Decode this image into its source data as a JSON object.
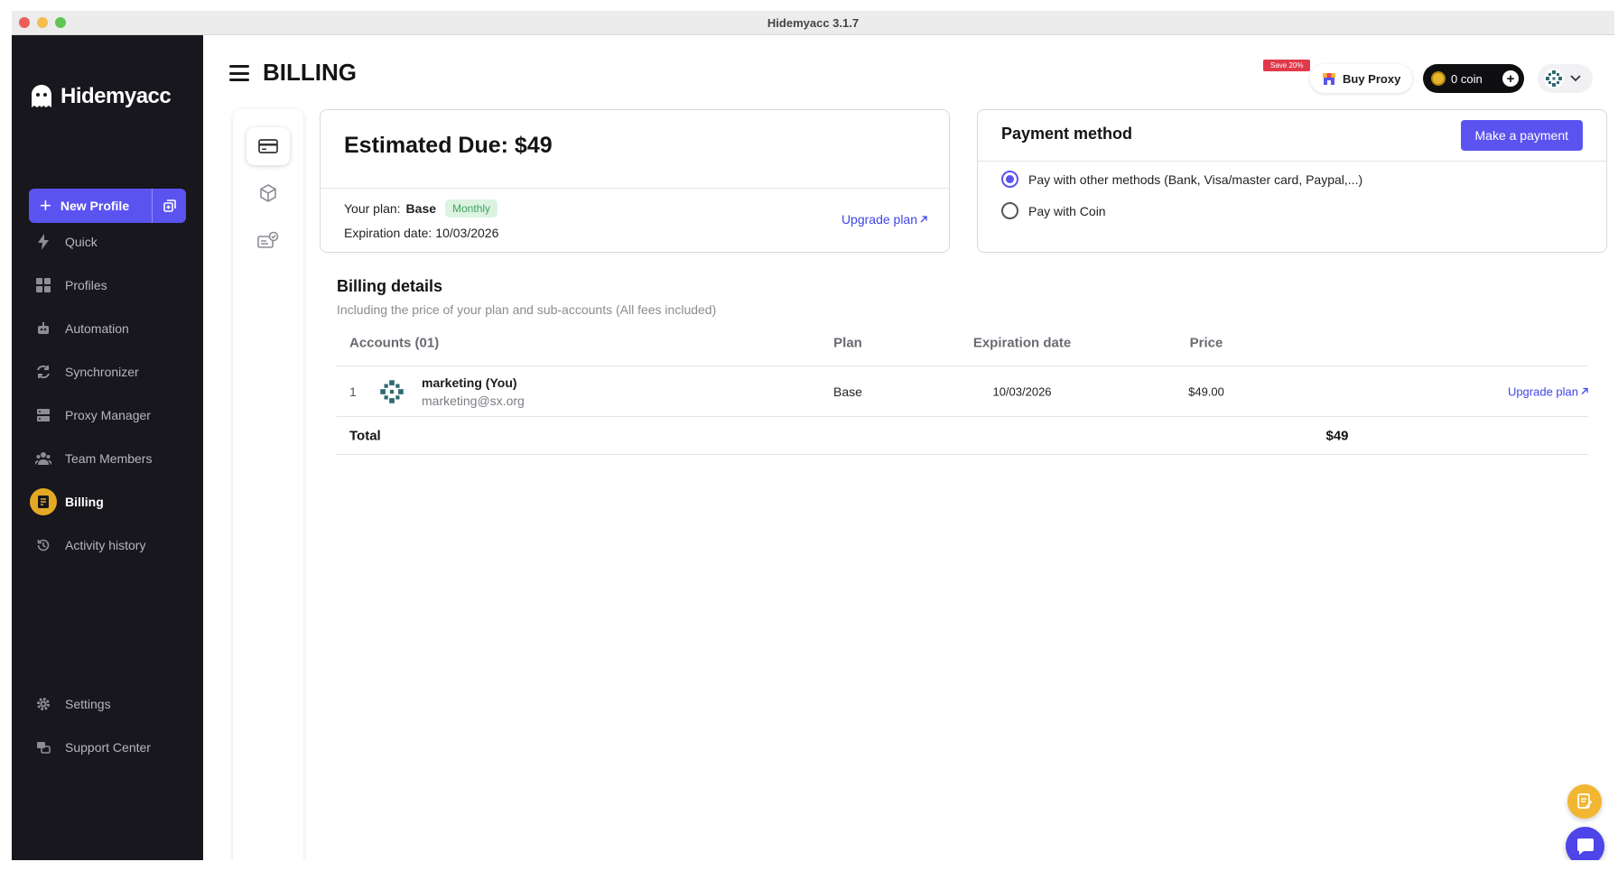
{
  "window": {
    "title": "Hidemyacc 3.1.7"
  },
  "sidebar": {
    "logo": "Hidemyacc",
    "new_profile": "New Profile",
    "items": [
      {
        "label": "Quick",
        "icon": "bolt-icon"
      },
      {
        "label": "Profiles",
        "icon": "grid-icon"
      },
      {
        "label": "Automation",
        "icon": "robot-icon"
      },
      {
        "label": "Synchronizer",
        "icon": "sync-icon"
      },
      {
        "label": "Proxy Manager",
        "icon": "server-icon"
      },
      {
        "label": "Team Members",
        "icon": "team-icon"
      },
      {
        "label": "Billing",
        "icon": "billing-icon"
      },
      {
        "label": "Activity history",
        "icon": "history-icon"
      }
    ],
    "bottom": [
      {
        "label": "Settings",
        "icon": "gear-icon"
      },
      {
        "label": "Support Center",
        "icon": "support-icon"
      }
    ]
  },
  "header": {
    "title": "BILLING",
    "save_badge": "Save 20%",
    "buy_proxy": "Buy Proxy",
    "coin": "0 coin"
  },
  "estimate": {
    "title": "Estimated Due: $49",
    "plan_label": "Your plan:",
    "plan_name": "Base",
    "cycle": "Monthly",
    "expiration_label": "Expiration date:",
    "expiration": "10/03/2026",
    "upgrade": "Upgrade plan"
  },
  "payment": {
    "title": "Payment method",
    "button": "Make a payment",
    "options": [
      {
        "label": "Pay with other methods (Bank, Visa/master card, Paypal,...)",
        "selected": true
      },
      {
        "label": "Pay with Coin",
        "selected": false
      }
    ]
  },
  "billing": {
    "title": "Billing details",
    "subtitle": "Including the price of your plan and sub-accounts (All fees included)",
    "columns": [
      "Accounts (01)",
      "Plan",
      "Expiration date",
      "Price"
    ],
    "rows": [
      {
        "index": "1",
        "name": "marketing (You)",
        "email": "marketing@sx.org",
        "plan": "Base",
        "expiration": "10/03/2026",
        "price": "$49.00",
        "action": "Upgrade plan"
      }
    ],
    "total_label": "Total",
    "total_value": "$49"
  },
  "colors": {
    "accent": "#5b53f0",
    "sidebar_bg": "#17171d",
    "billing_active": "#e3a925",
    "link": "#3f46e6"
  }
}
